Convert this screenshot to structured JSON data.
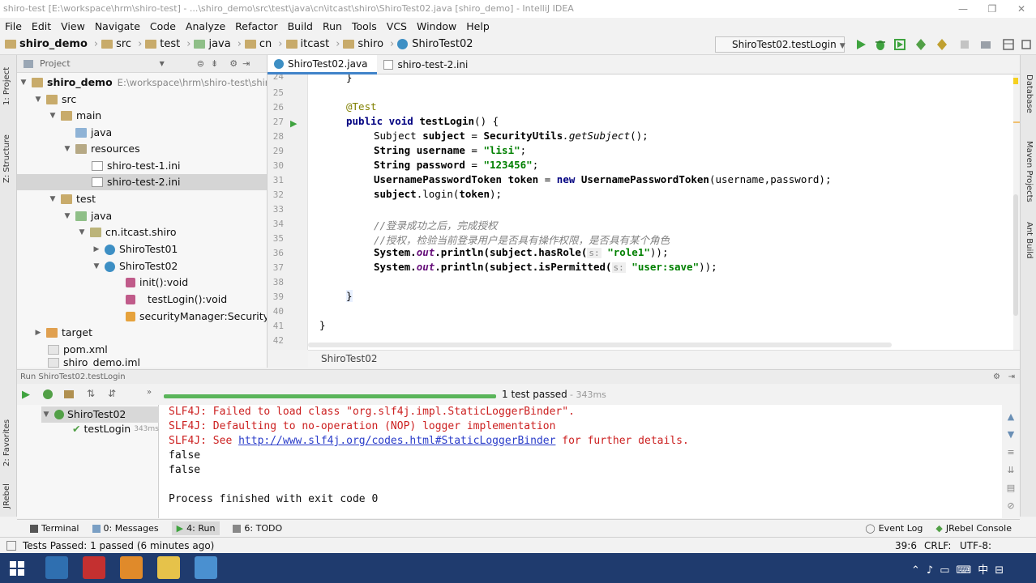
{
  "window": {
    "title": "shiro-test [E:\\workspace\\hrm\\shiro-test] - ...\\shiro_demo\\src\\test\\java\\cn\\itcast\\shiro\\ShiroTest02.java [shiro_demo] - IntelliJ IDEA"
  },
  "menu": [
    "File",
    "Edit",
    "View",
    "Navigate",
    "Code",
    "Analyze",
    "Refactor",
    "Build",
    "Run",
    "Tools",
    "VCS",
    "Window",
    "Help"
  ],
  "breadcrumbs": [
    "shiro_demo",
    "src",
    "test",
    "java",
    "cn",
    "itcast",
    "shiro",
    "ShiroTest02"
  ],
  "run_config": "ShiroTest02.testLogin",
  "left_strip": {
    "project": "1: Project",
    "structure": "Z: Structure",
    "favorites": "2: Favorites",
    "jrebel": "JRebel"
  },
  "right_strip": {
    "database": "Database",
    "maven": "Maven Projects",
    "ant": "Ant Build"
  },
  "project_panel": {
    "label": "Project"
  },
  "tree": [
    {
      "label": "shiro_demo",
      "extra": "E:\\workspace\\hrm\\shiro-test\\shiro"
    },
    {
      "label": "src"
    },
    {
      "label": "main"
    },
    {
      "label": "java"
    },
    {
      "label": "resources"
    },
    {
      "label": "shiro-test-1.ini"
    },
    {
      "label": "shiro-test-2.ini"
    },
    {
      "label": "test"
    },
    {
      "label": "java"
    },
    {
      "label": "cn.itcast.shiro"
    },
    {
      "label": "ShiroTest01"
    },
    {
      "label": "ShiroTest02"
    },
    {
      "label": "init():void"
    },
    {
      "label": "testLogin():void"
    },
    {
      "label": "securityManager:SecurityM"
    },
    {
      "label": "target"
    },
    {
      "label": "pom.xml"
    },
    {
      "label": "shiro_demo.iml"
    }
  ],
  "tabs": [
    {
      "label": "ShiroTest02.java"
    },
    {
      "label": "shiro-test-2.ini"
    }
  ],
  "line_numbers": [
    "24",
    "25",
    "26",
    "27",
    "28",
    "29",
    "30",
    "31",
    "32",
    "33",
    "34",
    "35",
    "36",
    "37",
    "38",
    "39",
    "40",
    "41",
    "42"
  ],
  "code": {
    "l24": "}",
    "l26": "@Test",
    "l27_kw": "public void ",
    "l27_m": "testLogin",
    "l27_end": "() {",
    "l28_a": "Subject ",
    "l28_b": "subject",
    "l28_c": " = ",
    "l28_d": "SecurityUtils",
    "l28_e": ".getSubject",
    "l28_f": "();",
    "l29_a": "String ",
    "l29_b": "username",
    "l29_c": " = ",
    "l29_d": "\"lisi\"",
    "l29_e": ";",
    "l30_a": "String ",
    "l30_b": "password",
    "l30_c": " = ",
    "l30_d": "\"123456\"",
    "l30_e": ";",
    "l31_a": "UsernamePasswordToken ",
    "l31_b": "token",
    "l31_c": " = ",
    "l31_d": "new ",
    "l31_e": "UsernamePasswordToken",
    "l31_f": "(username,password);",
    "l32_a": "subject",
    "l32_b": ".login(",
    "l32_c": "token",
    "l32_d": ");",
    "l34": "//登录成功之后，完成授权",
    "l35": "//授权，检验当前登录用户是否具有操作权限，是否具有某个角色",
    "l36_a": "System.",
    "l36_b": "out",
    "l36_c": ".println(",
    "l36_d": "subject",
    "l36_e": ".hasRole(",
    "l36_hint": "s:",
    "l36_str": " \"role1\"",
    "l36_end": "));",
    "l37_a": "System.",
    "l37_b": "out",
    "l37_c": ".println(",
    "l37_d": "subject",
    "l37_e": ".isPermitted(",
    "l37_hint": "s:",
    "l37_str": " \"user:save\"",
    "l37_end": "));",
    "l39": "}",
    "l41": "}"
  },
  "editor_footer": "ShiroTest02",
  "run_panel": {
    "header": "Run   ShiroTest02.testLogin",
    "status": "1 test passed",
    "time": "- 343ms",
    "tests": [
      {
        "label": "ShiroTest02"
      },
      {
        "label": "testLogin",
        "time": "343ms"
      }
    ],
    "console": [
      "SLF4J: Failed to load class \"org.slf4j.impl.StaticLoggerBinder\".",
      "SLF4J: Defaulting to no-operation (NOP) logger implementation",
      "SLF4J: See ",
      "http://www.slf4j.org/codes.html#StaticLoggerBinder",
      " for further details.",
      "false",
      "false",
      "Process finished with exit code 0"
    ]
  },
  "bottom_tabs": [
    {
      "label": "Terminal"
    },
    {
      "label": "0: Messages"
    },
    {
      "label": "4: Run"
    },
    {
      "label": "6: TODO"
    }
  ],
  "bottom_right": {
    "event_log": "Event Log",
    "jrebel": "JRebel Console"
  },
  "statusbar": {
    "left": "Tests Passed: 1 passed (6 minutes ago)",
    "pos": "39:6",
    "crlf": "CRLF:",
    "enc": "UTF-8:"
  }
}
